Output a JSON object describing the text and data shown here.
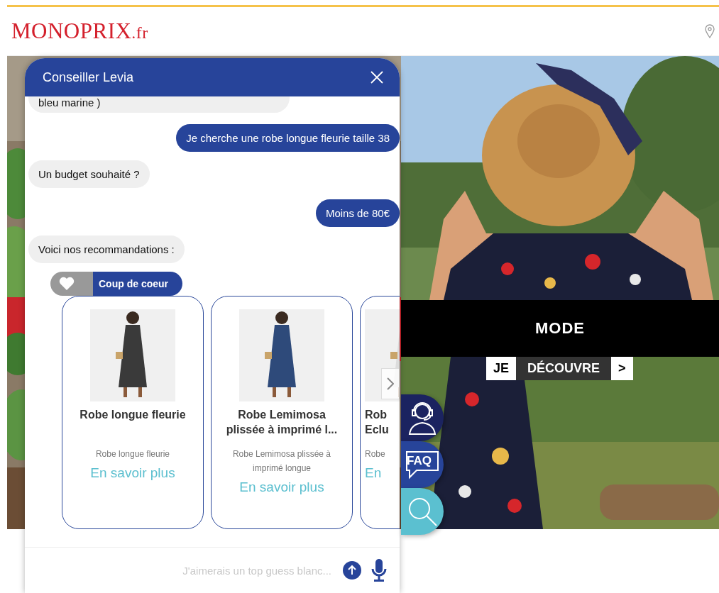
{
  "header": {
    "logo": "MONOPRIX",
    "logo_suffix": ".fr"
  },
  "hero": {
    "banner": "MODE",
    "cta": {
      "prefix": "JE",
      "label": "DÉCOUVRE",
      "arrow": ">"
    }
  },
  "chat": {
    "title": "Conseiller Levia",
    "messages": [
      {
        "kind": "bot",
        "text": "bleu marine )"
      },
      {
        "kind": "user",
        "text": "Je cherche une robe longue fleurie taille 38"
      },
      {
        "kind": "bot",
        "text": "Un budget souhaité ?"
      },
      {
        "kind": "user",
        "text": "Moins de 80€"
      },
      {
        "kind": "bot",
        "text": "Voici nos recommandations :"
      }
    ],
    "cards": [
      {
        "badge": "Coup de coeur",
        "title": "Robe longue fleurie",
        "description": "Robe longue fleurie",
        "link": "En savoir plus"
      },
      {
        "title": "Robe Lemimosa plissée à imprimé l...",
        "description": "Robe Lemimosa plissée à imprimé longue",
        "link": "En savoir plus"
      },
      {
        "title": "Rob Eclu",
        "description": "Robe",
        "link": "En"
      }
    ],
    "input": {
      "placeholder": "J'aimerais un top guess blanc..."
    }
  },
  "shortcuts": [
    {
      "kind": "agent"
    },
    {
      "kind": "faq",
      "label": "FAQ"
    },
    {
      "kind": "search"
    }
  ]
}
